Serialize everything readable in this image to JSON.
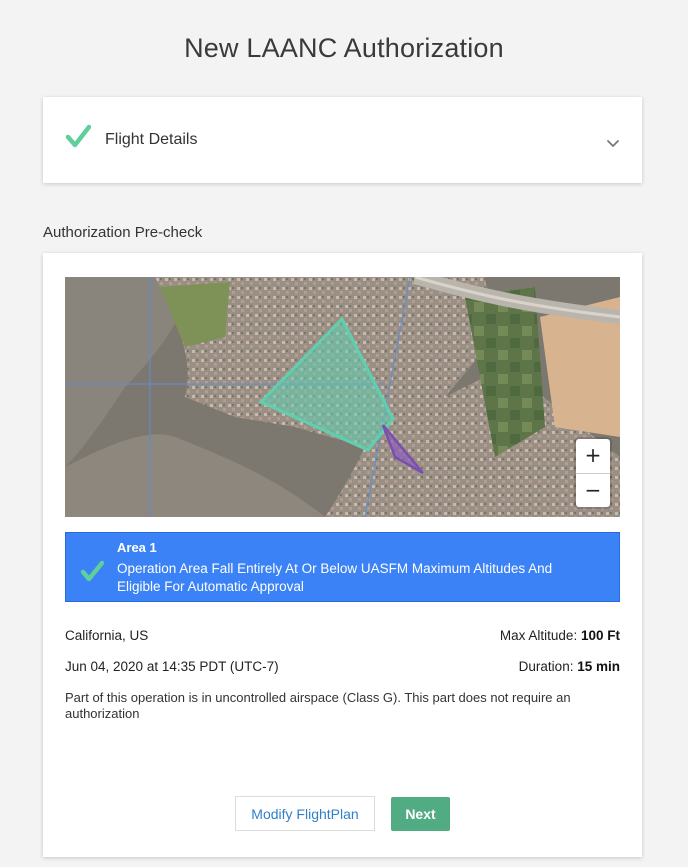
{
  "page": {
    "title": "New LAANC Authorization"
  },
  "flight_details": {
    "label": "Flight Details",
    "status_icon": "check-icon",
    "toggle_icon": "chevron-down-icon"
  },
  "precheck": {
    "section_label": "Authorization Pre-check",
    "map": {
      "zoom_in": "+",
      "zoom_out": "−"
    },
    "area": {
      "title": "Area 1",
      "description": "Operation Area Fall Entirely At Or Below UASFM Maximum Altitudes And Eligible For Automatic Approval"
    },
    "location": "California, US",
    "max_altitude_label": "Max Altitude:",
    "max_altitude_value": "100 Ft",
    "datetime": "Jun 04, 2020 at 14:35 PDT (UTC-7)",
    "duration_label": "Duration:",
    "duration_value": "15 min",
    "note": "Part of this operation is in uncontrolled airspace (Class G). This part does not require an authorization"
  },
  "buttons": {
    "modify": "Modify FlightPlan",
    "next": "Next"
  },
  "colors": {
    "check_green": "#5fcf9b",
    "banner_blue": "#3b82f6",
    "next_green": "#52ac83",
    "link_blue": "#2f80c8"
  }
}
